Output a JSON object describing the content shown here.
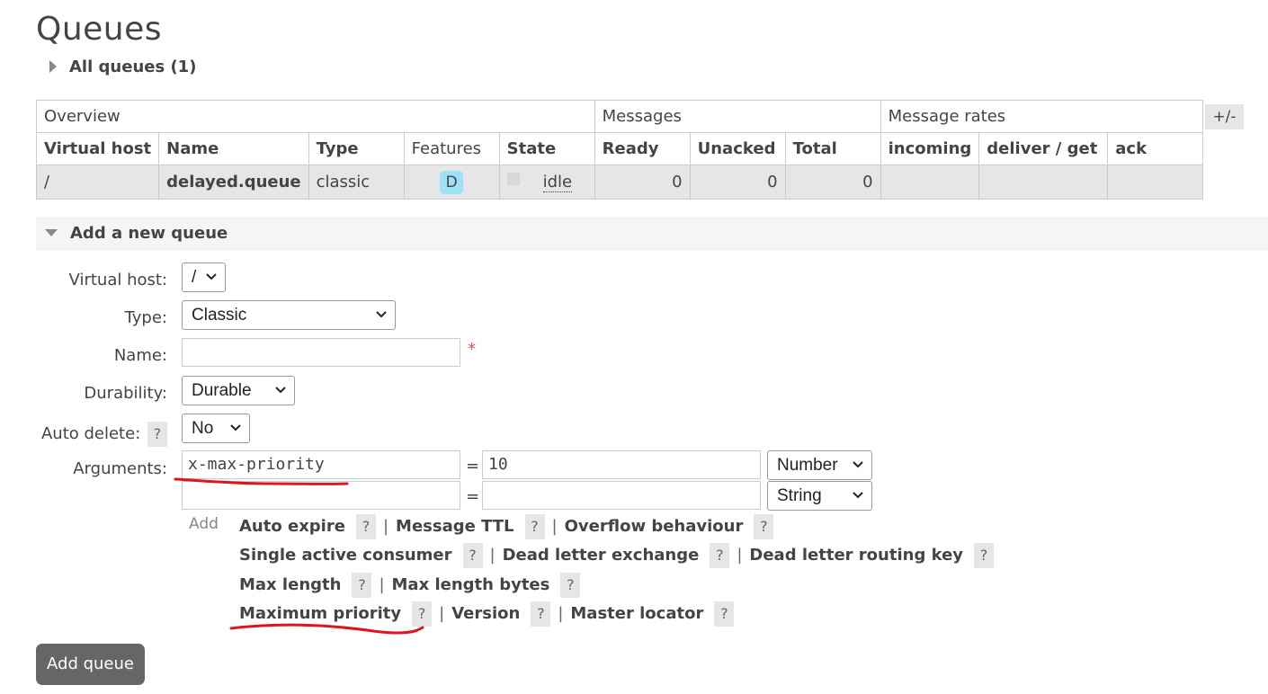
{
  "page": {
    "title": "Queues",
    "all_queues_label": "All queues (1)"
  },
  "table": {
    "groups": {
      "overview": "Overview",
      "messages": "Messages",
      "message_rates": "Message rates"
    },
    "headers": {
      "virtual_host": "Virtual host",
      "name": "Name",
      "type": "Type",
      "features": "Features",
      "state": "State",
      "ready": "Ready",
      "unacked": "Unacked",
      "total": "Total",
      "incoming": "incoming",
      "deliver_get": "deliver / get",
      "ack": "ack"
    },
    "row": {
      "virtual_host": "/",
      "name": "delayed.queue",
      "type": "classic",
      "feature_badge": "D",
      "state": "idle",
      "ready": "0",
      "unacked": "0",
      "total": "0",
      "incoming": "",
      "deliver_get": "",
      "ack": ""
    },
    "toggle_columns": "+/-"
  },
  "add_queue": {
    "section_title": "Add a new queue",
    "labels": {
      "virtual_host": "Virtual host:",
      "type": "Type:",
      "name": "Name:",
      "durability": "Durability:",
      "auto_delete": "Auto delete:",
      "arguments": "Arguments:"
    },
    "values": {
      "virtual_host": "/",
      "type": "Classic",
      "name": "",
      "durability": "Durable",
      "auto_delete": "No"
    },
    "required_mark": "*",
    "help": "?",
    "arguments": [
      {
        "key": "x-max-priority",
        "value": "10",
        "type": "Number"
      },
      {
        "key": "",
        "value": "",
        "type": "String"
      }
    ],
    "equals": "=",
    "add_link": "Add",
    "helpers": [
      [
        "Auto expire",
        "Message TTL",
        "Overflow behaviour"
      ],
      [
        "Single active consumer",
        "Dead letter exchange",
        "Dead letter routing key"
      ],
      [
        "Max length",
        "Max length bytes"
      ],
      [
        "Maximum priority",
        "Version",
        "Master locator"
      ]
    ],
    "separator": "|",
    "submit_label": "Add queue"
  },
  "colors": {
    "annotation": "#e0141e",
    "badge": "#9ee0f5",
    "row_bg": "#e6e6e6",
    "button_bg": "#666666"
  }
}
